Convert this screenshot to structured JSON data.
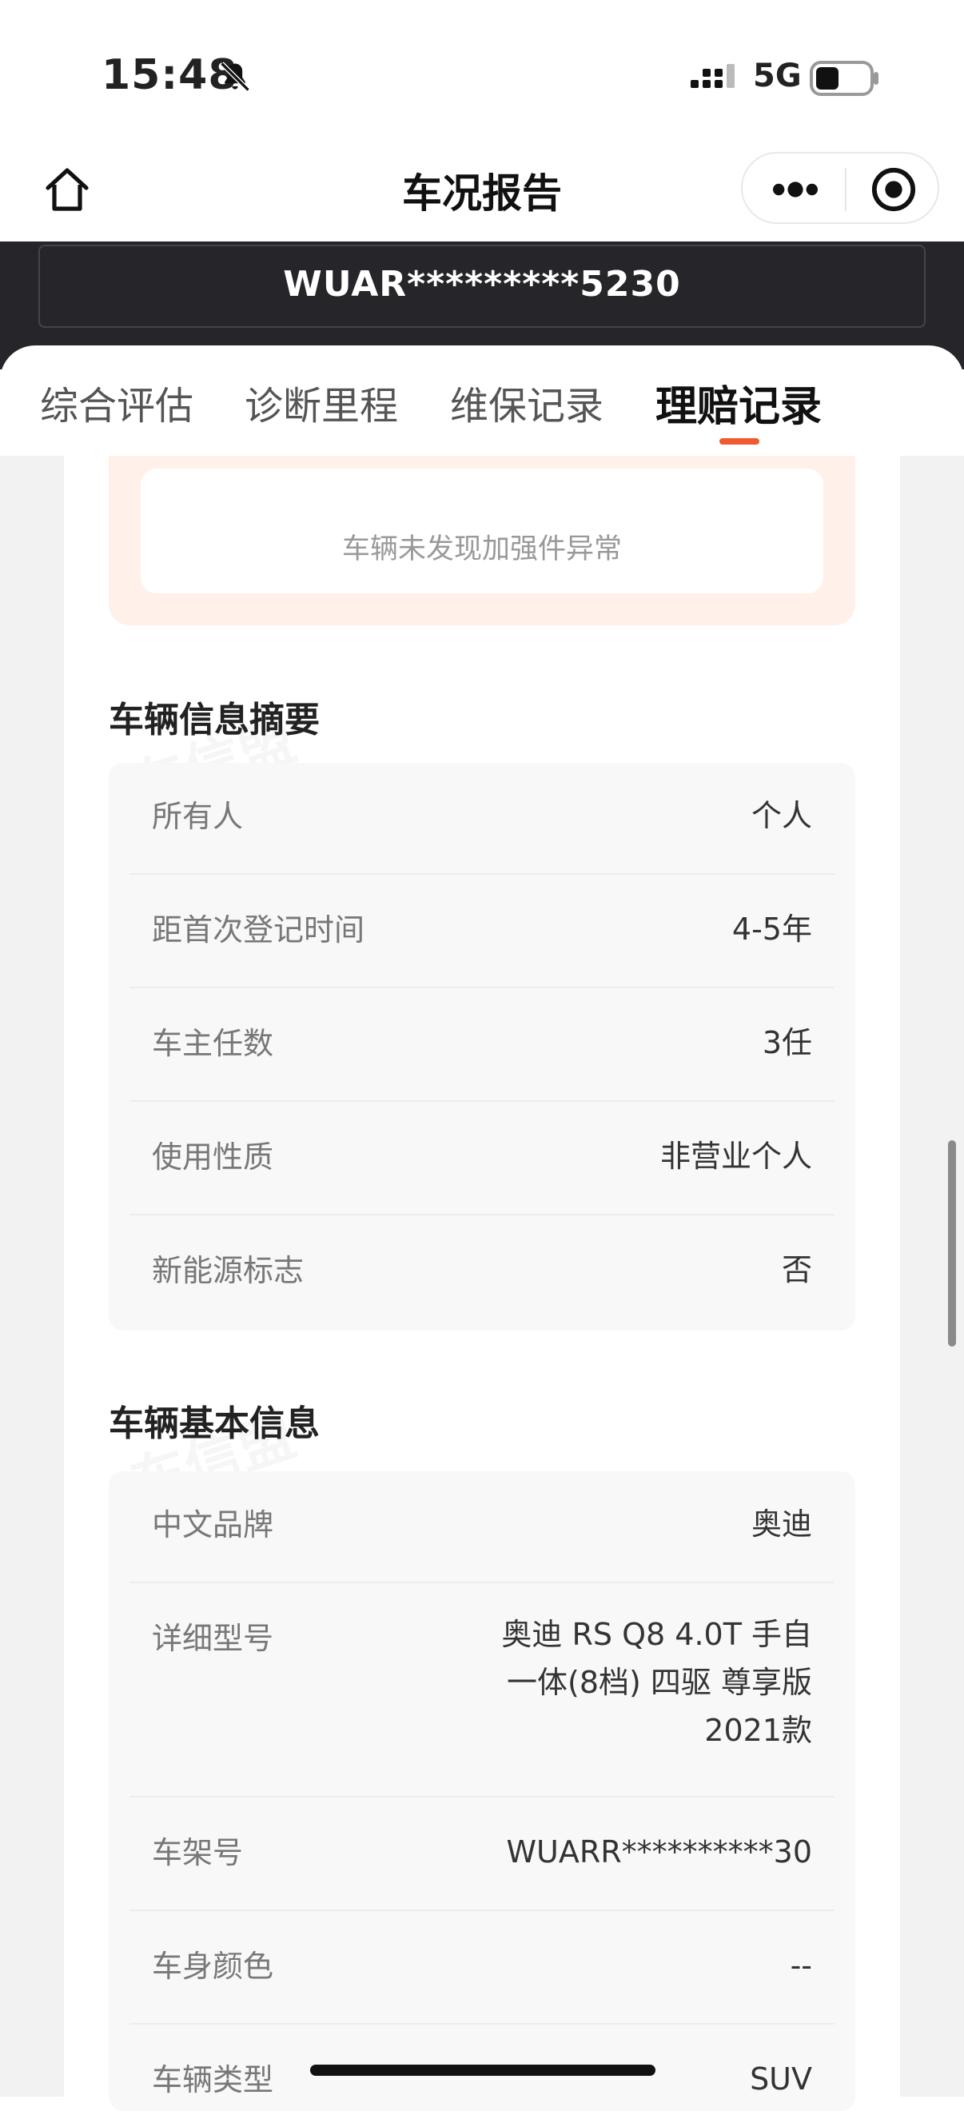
{
  "status_bar": {
    "time": "15:48",
    "network": "5G",
    "icons": [
      "bell-muted-icon",
      "signal-icon",
      "battery-icon"
    ]
  },
  "nav": {
    "title": "车况报告",
    "icons": [
      "home-icon",
      "more-icon",
      "target-icon"
    ]
  },
  "header": {
    "plate": "WUAR*********5230"
  },
  "tabs": [
    {
      "label": "综合评估"
    },
    {
      "label": "诊断里程"
    },
    {
      "label": "维保记录"
    },
    {
      "label": "理赔记录",
      "active": true
    }
  ],
  "alert": {
    "text": "车辆未发现加强件异常"
  },
  "summary": {
    "title": "车辆信息摘要",
    "rows": [
      {
        "key": "所有人",
        "value": "个人"
      },
      {
        "key": "距首次登记时间",
        "value": "4-5年"
      },
      {
        "key": "车主任数",
        "value": "3任"
      },
      {
        "key": "使用性质",
        "value": "非营业个人"
      },
      {
        "key": "新能源标志",
        "value": "否"
      }
    ]
  },
  "basic": {
    "title": "车辆基本信息",
    "rows": [
      {
        "key": "中文品牌",
        "value": "奥迪"
      },
      {
        "key": "详细型号",
        "value_lines": [
          "奥迪 RS Q8 4.0T 手自",
          "一体(8档) 四驱 尊享版",
          "2021款"
        ]
      },
      {
        "key": "车架号",
        "value": "WUARR**********30"
      },
      {
        "key": "车身颜色",
        "value": "--"
      },
      {
        "key": "车辆类型",
        "value": "SUV"
      }
    ]
  },
  "watermark": "车信盟",
  "colors": {
    "accent": "#ef5a32",
    "header_dark": "#25252a",
    "alert_bg": "#fff1ea"
  }
}
